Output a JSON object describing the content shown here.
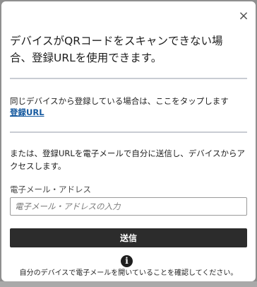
{
  "dialog": {
    "close_icon": "×",
    "heading": "デバイスがQRコードをスキャンできない場合、登録URLを使用できます。",
    "same_device_text": "同じデバイスから登録している場合は、ここをタップします",
    "register_link": "登録URL",
    "email_info_text": "または、登録URLを電子メールで自分に送信し、デバイスからアクセスします。",
    "email_label": "電子メール・アドレス",
    "email_placeholder": "電子メール・アドレスの入力",
    "email_value": "",
    "send_button": "送信",
    "info_icon": "i",
    "confirm_note": "自分のデバイスで電子メールを開いていることを確認してください。"
  }
}
